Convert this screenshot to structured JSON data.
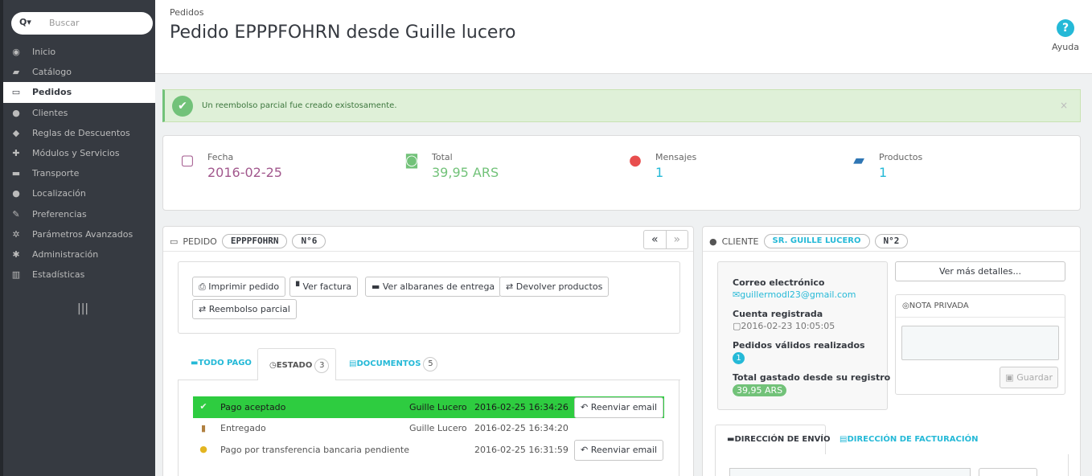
{
  "sidebar": {
    "search_placeholder": "Buscar",
    "search_toggle": "Q▾",
    "collapse_icon": "|||",
    "items": [
      {
        "label": "Inicio",
        "icon": "dashboard-icon"
      },
      {
        "label": "Catálogo",
        "icon": "book-icon"
      },
      {
        "label": "Pedidos",
        "icon": "credit-card-icon",
        "active": true
      },
      {
        "label": "Clientes",
        "icon": "users-icon"
      },
      {
        "label": "Reglas de Descuentos",
        "icon": "tags-icon"
      },
      {
        "label": "Módulos y Servicios",
        "icon": "puzzle-icon"
      },
      {
        "label": "Transporte",
        "icon": "truck-icon"
      },
      {
        "label": "Localización",
        "icon": "globe-icon"
      },
      {
        "label": "Preferencias",
        "icon": "wrench-icon"
      },
      {
        "label": "Parámetros Avanzados",
        "icon": "cogs-icon"
      },
      {
        "label": "Administración",
        "icon": "cog-icon"
      },
      {
        "label": "Estadísticas",
        "icon": "bar-chart-icon"
      }
    ]
  },
  "header": {
    "breadcrumb": "Pedidos",
    "title": "Pedido EPPPFOHRN desde Guille lucero",
    "help_label": "Ayuda",
    "help_icon": "?"
  },
  "alert": {
    "message": "Un reembolso parcial fue creado existosamente.",
    "close": "×"
  },
  "kpis": [
    {
      "label": "Fecha",
      "value": "2016-02-25",
      "icon": "calendar-icon",
      "color": "#a2588d"
    },
    {
      "label": "Total",
      "value": "39,95 ARS",
      "icon": "money-icon",
      "color": "#72c279"
    },
    {
      "label": "Mensajes",
      "value": "1",
      "icon": "comments-icon",
      "color": "#25b9d7"
    },
    {
      "label": "Productos",
      "value": "1",
      "icon": "book-icon",
      "color": "#25b9d7"
    }
  ],
  "order": {
    "heading": "PEDIDO",
    "reference": "EPPPFOHRN",
    "number": "N°6",
    "prev": "«",
    "next": "»",
    "buttons": {
      "print": "Imprimir pedido",
      "invoice": "Ver factura",
      "delivery": "Ver albaranes de entrega",
      "return": "Devolver productos",
      "refund": "Reembolso parcial"
    },
    "tabs": {
      "payment": "TODO PAGO",
      "status": "ESTADO",
      "status_count": "3",
      "documents": "DOCUMENTOS",
      "documents_count": "5"
    },
    "history": [
      {
        "status": "Pago aceptado",
        "employee": "Guille Lucero",
        "date": "2016-02-25 16:34:26",
        "resend": "Reenviar email",
        "highlight": true
      },
      {
        "status": "Entregado",
        "employee": "Guille Lucero",
        "date": "2016-02-25 16:34:20",
        "resend": ""
      },
      {
        "status": "Pago por transferencia bancaria pendiente",
        "employee": "",
        "date": "2016-02-25 16:31:59",
        "resend": "Reenviar email"
      }
    ]
  },
  "customer": {
    "heading": "CLIENTE",
    "name": "SR. GUILLE LUCERO",
    "number": "N°2",
    "email_label": "Correo electrónico",
    "email": "guillermodl23@gmail.com",
    "registered_label": "Cuenta registrada",
    "registered": "2016-02-23 10:05:05",
    "orders_label": "Pedidos válidos realizados",
    "orders": "1",
    "spent_label": "Total gastado desde su registro",
    "spent": "39,95 ARS",
    "more_details": "Ver más detalles...",
    "note_heading": "NOTA PRIVADA",
    "save": "Guardar",
    "tab_shipping": "DIRECCIÓN DE ENVÍO",
    "tab_billing": "DIRECCIÓN DE FACTURACIÓN"
  }
}
